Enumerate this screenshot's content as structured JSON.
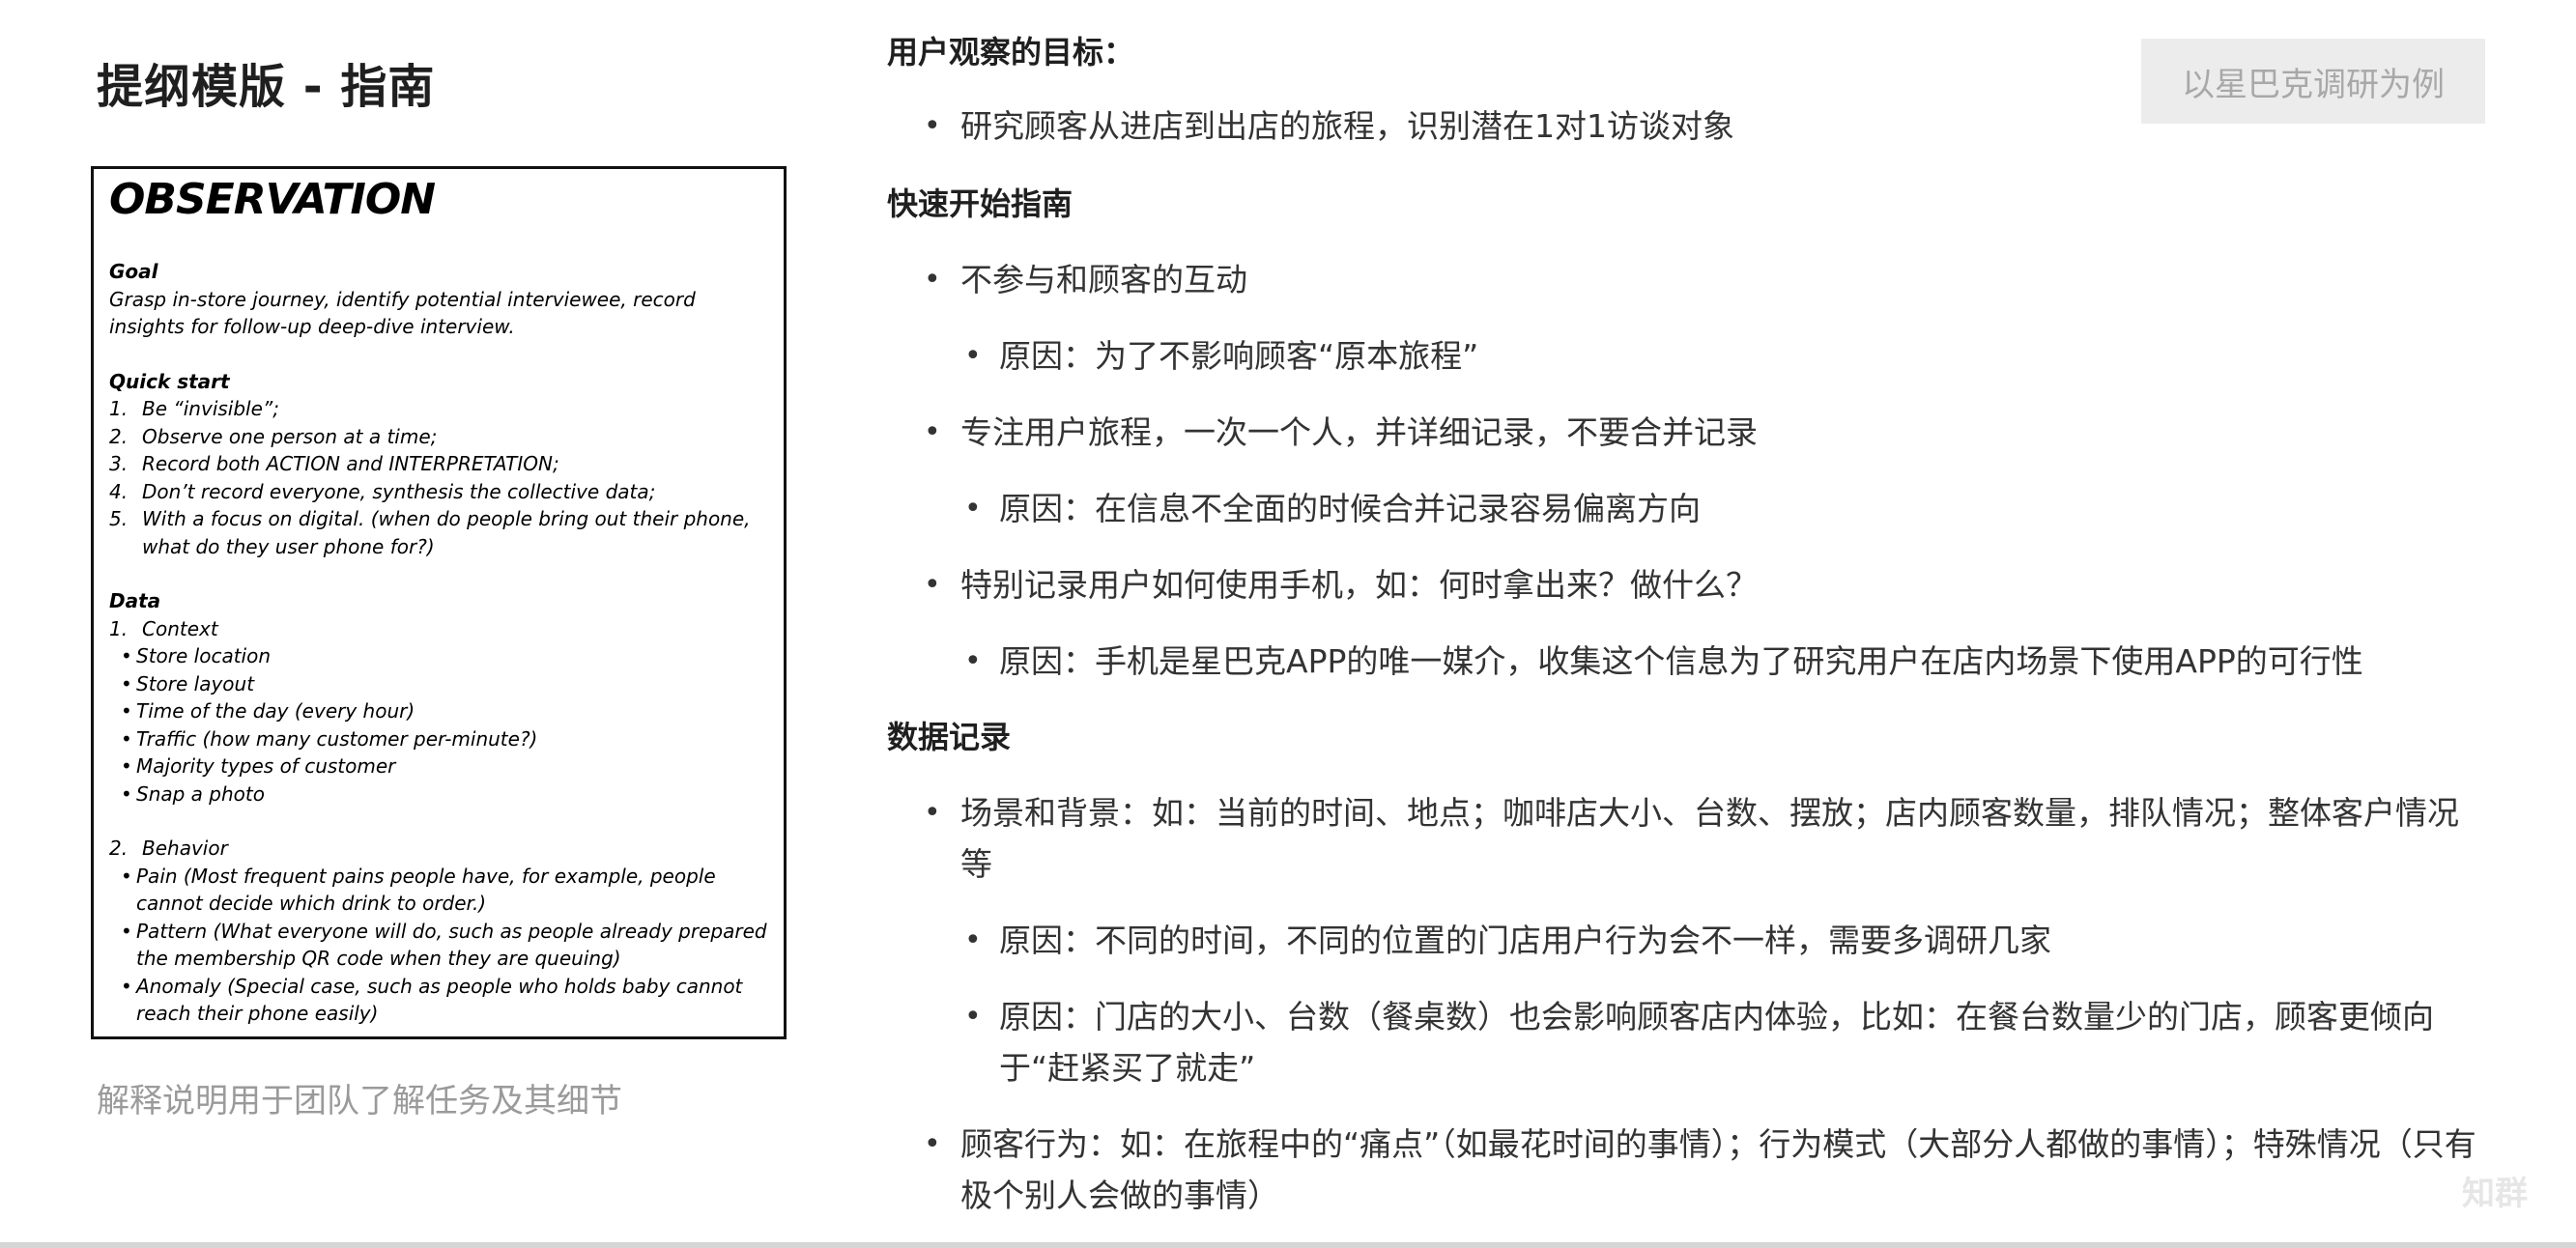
{
  "page_title": "提纲模版 - 指南",
  "observation_card": {
    "heading": "OBSERVATION",
    "goal": {
      "title": "Goal",
      "text": "Grasp in-store journey, identify potential interviewee, record insights for follow-up deep-dive interview."
    },
    "quick_start": {
      "title": "Quick start",
      "items": [
        {
          "num": "1.",
          "text": "Be “invisible”;"
        },
        {
          "num": "2.",
          "text": "Observe one person at a time;"
        },
        {
          "num": "3.",
          "text": "Record both ACTION and INTERPRETATION;"
        },
        {
          "num": "4.",
          "text": "Don’t record everyone, synthesis the collective data;"
        },
        {
          "num": "5.",
          "text": "With a focus on digital. (when do people bring out their phone, what do they user phone for?)"
        }
      ]
    },
    "data": {
      "title": "Data",
      "context": {
        "num": "1.",
        "title": "Context",
        "bullets": [
          "Store location",
          "Store layout",
          "Time of the day (every hour)",
          "Traffic (how many customer per-minute?)",
          "Majority types of customer",
          "Snap a photo"
        ]
      },
      "behavior": {
        "num": "2.",
        "title": "Behavior",
        "bullets": [
          "Pain (Most frequent pains people have, for example, people cannot decide which drink to order.)",
          "Pattern (What everyone will do, such as people already prepared the membership QR code when they are queuing)",
          "Anomaly (Special case, such as people who holds baby cannot reach their phone easily)"
        ]
      }
    }
  },
  "caption": "解释说明用于团队了解任务及其细节",
  "example_badge": "以星巴克调研为例",
  "guide": {
    "goal_heading": "用户观察的目标：",
    "goal_item": "研究顾客从进店到出店的旅程，识别潜在1对1访谈对象",
    "quickstart_heading": "快速开始指南",
    "qs": [
      {
        "text": "不参与和顾客的互动",
        "reason": "原因：为了不影响顾客“原本旅程”"
      },
      {
        "text": "专注用户旅程，一次一个人，并详细记录，不要合并记录",
        "reason": "原因：在信息不全面的时候合并记录容易偏离方向"
      },
      {
        "text": "特别记录用户如何使用手机，如：何时拿出来？做什么？",
        "reason": "原因：手机是星巴克APP的唯一媒介，收集这个信息为了研究用户在店内场景下使用APP的可行性"
      }
    ],
    "data_heading": "数据记录",
    "data_items": [
      {
        "text": "场景和背景：如：当前的时间、地点；咖啡店大小、台数、摆放；店内顾客数量，排队情况；整体客户情况等",
        "reasons": [
          "原因：不同的时间，不同的位置的门店用户行为会不一样，需要多调研几家",
          "原因：门店的大小、台数（餐桌数）也会影响顾客店内体验，比如：在餐台数量少的门店，顾客更倾向于“赶紧买了就走”"
        ]
      },
      {
        "text": "顾客行为：如：在旅程中的“痛点”（如最花时间的事情）；行为模式（大部分人都做的事情）；特殊情况（只有极个别人会做的事情）"
      }
    ]
  },
  "watermark": "知群"
}
